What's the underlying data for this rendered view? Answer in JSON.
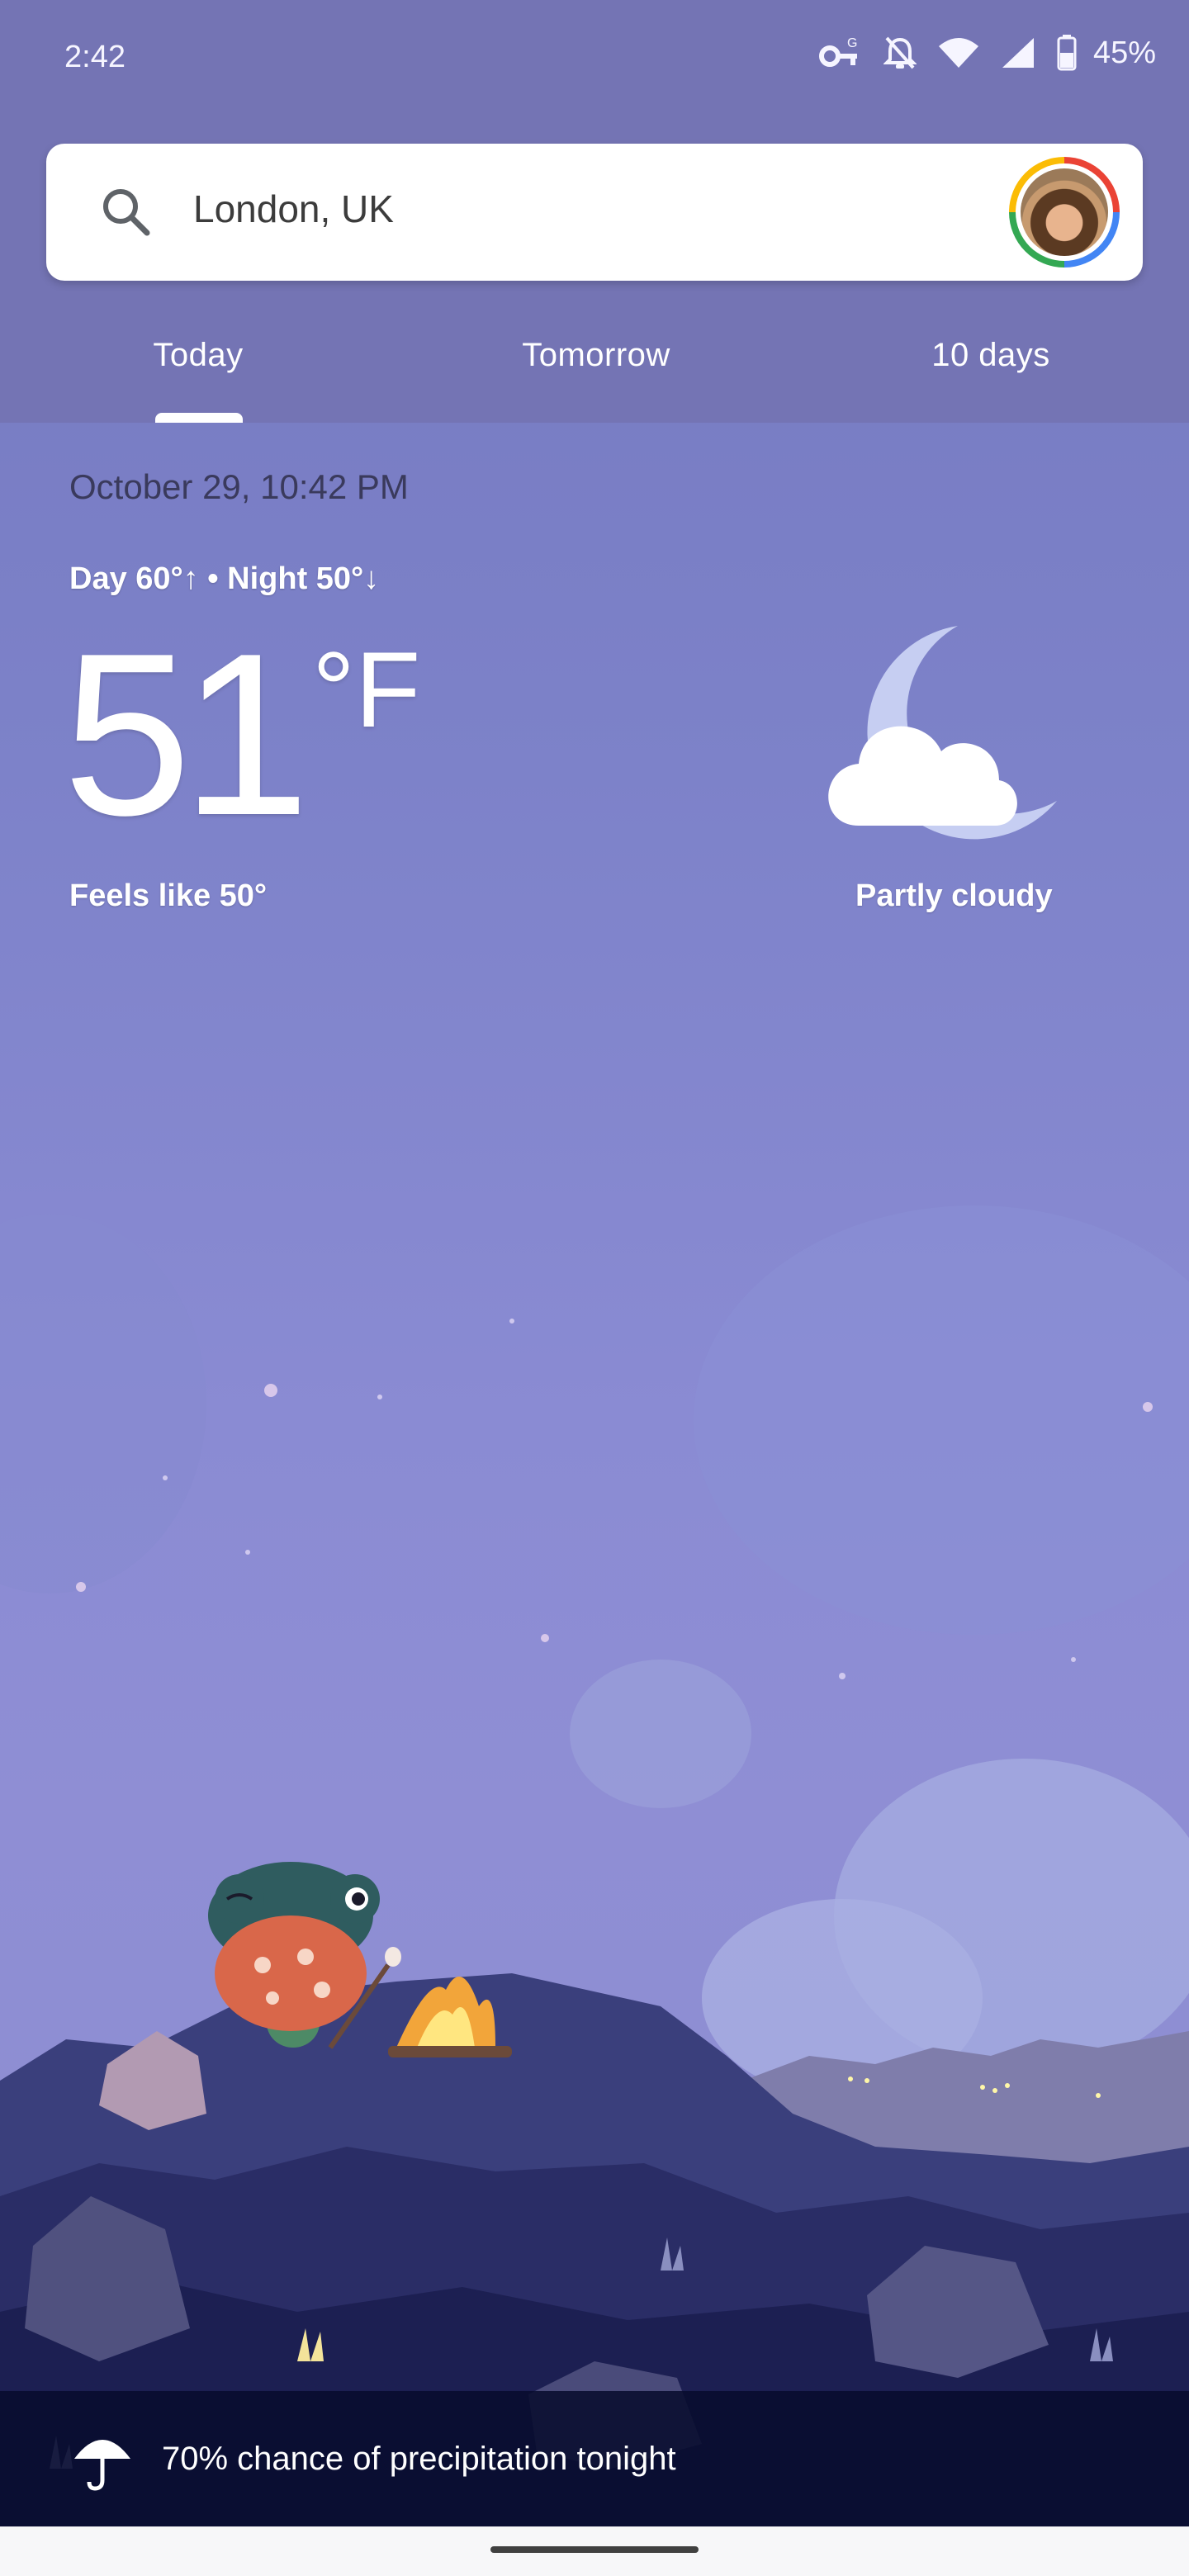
{
  "status_bar": {
    "time": "2:42",
    "battery": "45%",
    "icons": [
      "vpn-key-icon",
      "notifications-off-icon",
      "wifi-icon",
      "cell-signal-icon",
      "battery-icon"
    ]
  },
  "search": {
    "location": "London, UK",
    "icon": "search-icon"
  },
  "tabs": [
    {
      "label": "Today",
      "selected": true
    },
    {
      "label": "Tomorrow",
      "selected": false
    },
    {
      "label": "10 days",
      "selected": false
    }
  ],
  "weather": {
    "datetime": "October 29, 10:42 PM",
    "day_night": "Day 60°↑ • Night 50°↓",
    "temperature": "51",
    "unit": "°F",
    "feels_like": "Feels like 50°",
    "condition": "Partly cloudy",
    "condition_icon": "moon-cloud-icon"
  },
  "precipitation": {
    "text": "70% chance of precipitation tonight",
    "icon": "umbrella-icon"
  },
  "colors": {
    "header_bg": "#7474b4",
    "sky_top": "#7478bf",
    "sky_bottom": "#8c8dd0",
    "banner_bg": "#080c2e"
  }
}
